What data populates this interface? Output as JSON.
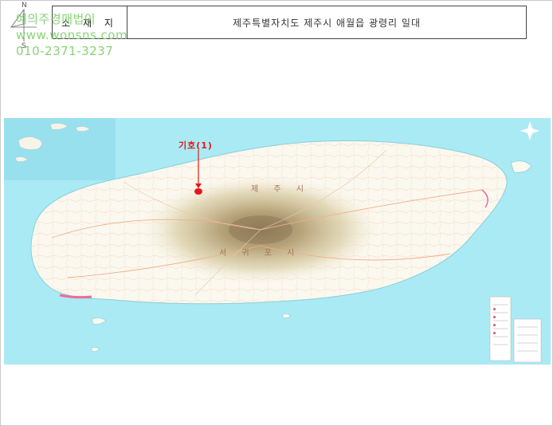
{
  "location": {
    "label": "소 재 지",
    "value": "제주특별자치도 제주시 애월읍 광령리 일대"
  },
  "watermark": {
    "line1": "예의주경매법이",
    "line2": "www.wonsns.com",
    "line3": "010-2371-3237"
  },
  "compass": {
    "north": "N",
    "south": "S"
  },
  "map": {
    "marker_label": "기호(1)",
    "city_north": "제 주 시",
    "city_south": "서 귀 포 시",
    "colors": {
      "sea": "#aaeaf4",
      "land": "#fbf8ef",
      "mountain": "#c7b48a",
      "marker": "#e31919"
    }
  }
}
